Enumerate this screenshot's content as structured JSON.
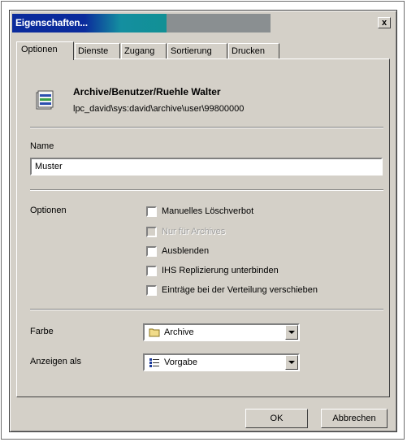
{
  "window": {
    "title": "Eigenschaften...",
    "close_label": "x"
  },
  "tabs": [
    {
      "label": "Optionen",
      "active": true
    },
    {
      "label": "Dienste",
      "active": false
    },
    {
      "label": "Zugang",
      "active": false
    },
    {
      "label": "Sortierung",
      "active": false
    },
    {
      "label": "Drucken",
      "active": false
    }
  ],
  "header": {
    "title": "Archive/Benutzer/Ruehle Walter",
    "path": "lpc_david\\sys:david\\archive\\user\\99800000"
  },
  "name": {
    "label": "Name",
    "value": "Muster"
  },
  "options": {
    "label": "Optionen",
    "items": [
      {
        "label": "Manuelles Löschverbot",
        "checked": false,
        "enabled": true
      },
      {
        "label": "Nur für Archives",
        "checked": false,
        "enabled": false
      },
      {
        "label": "Ausblenden",
        "checked": false,
        "enabled": true
      },
      {
        "label": "IHS Replizierung unterbinden",
        "checked": false,
        "enabled": true
      },
      {
        "label": "Einträge bei der Verteilung verschieben",
        "checked": false,
        "enabled": true
      }
    ]
  },
  "farbe": {
    "label": "Farbe",
    "value": "Archive",
    "icon": "folder-icon"
  },
  "anzeigen": {
    "label": "Anzeigen als",
    "value": "Vorgabe",
    "icon": "list-icon"
  },
  "buttons": {
    "ok": "OK",
    "cancel": "Abbrechen"
  }
}
